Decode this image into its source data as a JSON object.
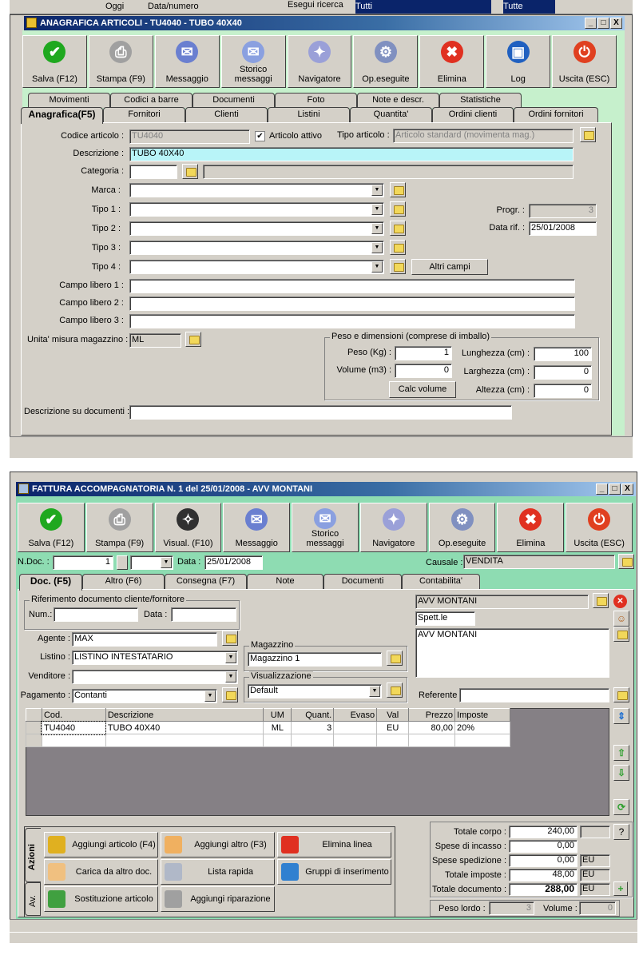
{
  "background": {
    "items": [
      "Oggi",
      "Data/numero",
      "Esegui ricerca",
      "Tutti",
      "Tutte"
    ]
  },
  "articoli": {
    "title": "ANAGRAFICA ARTICOLI - TU4040 - TUBO 40X40",
    "toolbar": [
      {
        "label": "Salva (F12)",
        "icon": "check-icon",
        "color": "#1fa81f",
        "glyph": "✔"
      },
      {
        "label": "Stampa (F9)",
        "icon": "printer-icon",
        "color": "#a0a0a0",
        "glyph": "⎙"
      },
      {
        "label": "Messaggio",
        "icon": "envelope-pen-icon",
        "color": "#6a7fd0",
        "glyph": "✉"
      },
      {
        "label": "Storico messaggi",
        "icon": "envelope-search-icon",
        "color": "#8aa0e0",
        "glyph": "✉"
      },
      {
        "label": "Navigatore",
        "icon": "compass-icon",
        "color": "#9aa0d8",
        "glyph": "✦"
      },
      {
        "label": "Op.eseguite",
        "icon": "gears-icon",
        "color": "#8090c0",
        "glyph": "⚙"
      },
      {
        "label": "Elimina",
        "icon": "delete-x-icon",
        "color": "#e03020",
        "glyph": "✖"
      },
      {
        "label": "Log",
        "icon": "book-search-icon",
        "color": "#2060c0",
        "glyph": "▣"
      },
      {
        "label": "Uscita (ESC)",
        "icon": "power-icon",
        "color": "#e04020",
        "glyph": "⏻"
      }
    ],
    "tabs_row1": [
      "Movimenti",
      "Codici a barre",
      "Documenti",
      "Foto",
      "Note e descr.",
      "Statistiche"
    ],
    "tabs_row2": [
      "Anagrafica(F5)",
      "Fornitori",
      "Clienti",
      "Listini",
      "Quantita'",
      "Ordini clienti",
      "Ordini fornitori"
    ],
    "form": {
      "codice_label": "Codice articolo :",
      "codice": "TU4040",
      "attivo_label": "Articolo attivo",
      "attivo": true,
      "tipo_articolo_label": "Tipo articolo :",
      "tipo_articolo": "Articolo standard (movimenta mag.)",
      "descrizione_label": "Descrizione :",
      "descrizione": "TUBO 40X40",
      "categoria_label": "Categoria :",
      "categoria": "",
      "marca_label": "Marca :",
      "tipo1_label": "Tipo 1 :",
      "tipo2_label": "Tipo 2 :",
      "tipo3_label": "Tipo 3 :",
      "tipo4_label": "Tipo 4 :",
      "altri_campi": "Altri campi",
      "progr_label": "Progr. :",
      "progr": "3",
      "data_rif_label": "Data rif. :",
      "data_rif": "25/01/2008",
      "campo1_label": "Campo libero 1 :",
      "campo2_label": "Campo libero 2 :",
      "campo3_label": "Campo libero 3 :",
      "um_label": "Unita' misura magazzino :",
      "um": "ML",
      "peso_group": "Peso e dimensioni (comprese di imballo)",
      "peso_label": "Peso (Kg) :",
      "peso": "1",
      "volume_label": "Volume (m3) :",
      "volume": "0",
      "lunghezza_label": "Lunghezza (cm) :",
      "lunghezza": "100",
      "larghezza_label": "Larghezza (cm) :",
      "larghezza": "0",
      "altezza_label": "Altezza (cm) :",
      "altezza": "0",
      "calc_volume": "Calc volume",
      "desc_doc_label": "Descrizione su documenti :",
      "desc_doc": ""
    }
  },
  "fattura": {
    "title": "FATTURA ACCOMPAGNATORIA N. 1  del 25/01/2008 - AVV MONTANI",
    "toolbar": [
      {
        "label": "Salva (F12)",
        "icon": "check-icon",
        "color": "#1fa81f",
        "glyph": "✔"
      },
      {
        "label": "Stampa (F9)",
        "icon": "printer-icon",
        "color": "#a0a0a0",
        "glyph": "⎙"
      },
      {
        "label": "Visual. (F10)",
        "icon": "magic-wand-icon",
        "color": "#303030",
        "glyph": "✧"
      },
      {
        "label": "Messaggio",
        "icon": "envelope-pen-icon",
        "color": "#6a7fd0",
        "glyph": "✉"
      },
      {
        "label": "Storico messaggi",
        "icon": "envelope-search-icon",
        "color": "#8aa0e0",
        "glyph": "✉"
      },
      {
        "label": "Navigatore",
        "icon": "compass-icon",
        "color": "#9aa0d8",
        "glyph": "✦"
      },
      {
        "label": "Op.eseguite",
        "icon": "gears-icon",
        "color": "#8090c0",
        "glyph": "⚙"
      },
      {
        "label": "Elimina",
        "icon": "delete-x-icon",
        "color": "#e03020",
        "glyph": "✖"
      },
      {
        "label": "Uscita (ESC)",
        "icon": "power-icon",
        "color": "#e04020",
        "glyph": "⏻"
      }
    ],
    "ndoc_label": "N.Doc. :",
    "ndoc": "1",
    "data_label": "Data :",
    "data": "25/01/2008",
    "causale_label": "Causale :",
    "causale": "VENDITA",
    "tabs": [
      "Doc. (F5)",
      "Altro (F6)",
      "Consegna (F7)",
      "Note",
      "Documenti",
      "Contabilita'"
    ],
    "rif_group": "Riferimento documento cliente/fornitore",
    "num_label": "Num.:",
    "num": "",
    "rif_data_label": "Data :",
    "rif_data": "",
    "agente_label": "Agente :",
    "agente": "MAX",
    "listino_label": "Listino :",
    "listino": "LISTINO INTESTATARIO",
    "venditore_label": "Venditore :",
    "venditore": "",
    "pagamento_label": "Pagamento :",
    "pagamento": "Contanti",
    "magazzino_group": "Magazzino",
    "magazzino": "Magazzino 1",
    "visual_group": "Visualizzazione",
    "visual": "Default",
    "cliente": "AVV MONTANI",
    "spett": "Spett.le",
    "indirizzo": "AVV MONTANI",
    "referente_label": "Referente",
    "referente": "",
    "grid": {
      "headers": [
        "",
        "Cod.",
        "Descrizione",
        "UM",
        "Quant.",
        "Evaso",
        "Val",
        "Prezzo",
        "Imposte"
      ],
      "rows": [
        [
          "",
          "TU4040",
          "TUBO 40X40",
          "ML",
          "3",
          "",
          "EU",
          "80,00",
          "20%"
        ],
        [
          "",
          "",
          "",
          "",
          "",
          "",
          "",
          "",
          ""
        ]
      ]
    },
    "side_tabs": [
      "Azioni",
      "Av."
    ],
    "actions": [
      {
        "label": "Aggiungi articolo (F4)",
        "icon": "add-article-icon",
        "color": "#e0b020"
      },
      {
        "label": "Aggiungi altro (F3)",
        "icon": "add-grid-icon",
        "color": "#f0b060"
      },
      {
        "label": "Elimina linea",
        "icon": "delete-x-icon",
        "color": "#e03020"
      },
      {
        "label": "Carica da altro doc.",
        "icon": "load-doc-icon",
        "color": "#f0c080"
      },
      {
        "label": "Lista rapida",
        "icon": "quick-list-icon",
        "color": "#b0b8c8"
      },
      {
        "label": "Gruppi di inserimento",
        "icon": "groups-icon",
        "color": "#3080d0"
      },
      {
        "label": "Sostituzione articolo",
        "icon": "replace-icon",
        "color": "#40a040"
      },
      {
        "label": "Aggiungi riparazione",
        "icon": "wrench-icon",
        "color": "#a0a0a0"
      }
    ],
    "totals": {
      "corpo_label": "Totale corpo :",
      "corpo": "240,00",
      "incasso_label": "Spese di incasso :",
      "incasso": "0,00",
      "spedizione_label": "Spese spedizione :",
      "spedizione": "0,00",
      "spedizione_val": "EU",
      "imposte_label": "Totale imposte :",
      "imposte": "48,00",
      "imposte_val": "EU",
      "documento_label": "Totale documento :",
      "documento": "288,00",
      "documento_val": "EU",
      "help": "?",
      "peso_label": "Peso lordo :",
      "peso": "3",
      "volume_label": "Volume :",
      "volume": "0"
    }
  }
}
